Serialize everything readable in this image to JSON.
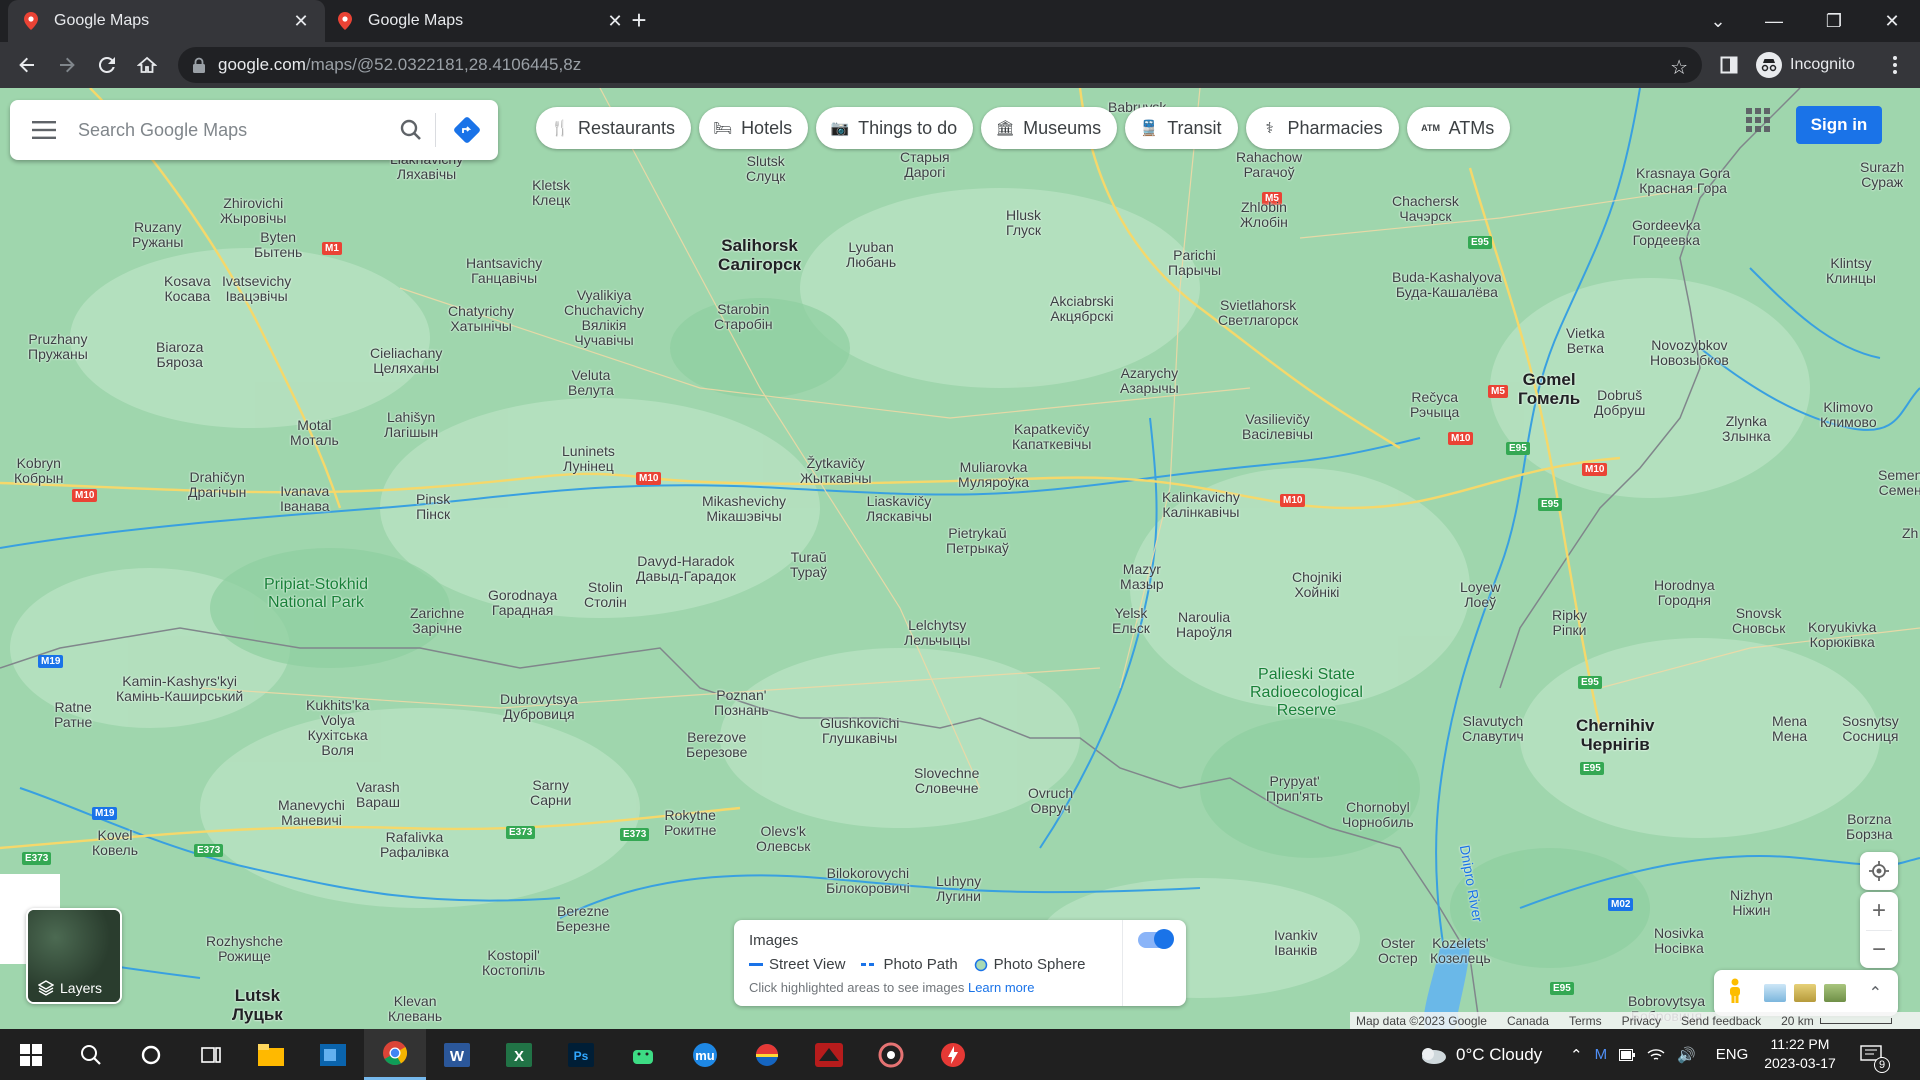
{
  "browser": {
    "tabs": [
      {
        "title": "Google Maps",
        "active": true
      },
      {
        "title": "Google Maps",
        "active": false
      }
    ],
    "new_tab_symbol": "+",
    "url_host": "google.com",
    "url_path": "/maps/@52.0322181,28.4106445,8z",
    "profile_label": "Incognito"
  },
  "maps": {
    "search_placeholder": "Search Google Maps",
    "chips": [
      {
        "label": "Restaurants",
        "icon": "fork-knife-icon"
      },
      {
        "label": "Hotels",
        "icon": "bed-icon"
      },
      {
        "label": "Things to do",
        "icon": "camera-icon"
      },
      {
        "label": "Museums",
        "icon": "museum-icon"
      },
      {
        "label": "Transit",
        "icon": "train-icon"
      },
      {
        "label": "Pharmacies",
        "icon": "pharmacy-icon"
      },
      {
        "label": "ATMs",
        "icon": "atm-icon"
      }
    ],
    "sign_in": "Sign in",
    "layers_label": "Layers",
    "images_panel": {
      "title": "Images",
      "street_view": "Street View",
      "photo_path": "Photo Path",
      "photo_sphere": "Photo Sphere",
      "note": "Click highlighted areas to see images",
      "learn_more": "Learn more",
      "toggle_on": true
    },
    "footer": {
      "map_data": "Map data ©2023 Google",
      "country": "Canada",
      "terms": "Terms",
      "privacy": "Privacy",
      "feedback": "Send feedback",
      "scale": "20 km"
    },
    "places": [
      {
        "name": "Babruysk",
        "cls": ""
      },
      {
        "name": "Slutsk\nСлуцк",
        "cls": ""
      },
      {
        "name": "Старыя\nДарогі",
        "cls": ""
      },
      {
        "name": "Soligorsk",
        "cls": "big"
      },
      {
        "name": "Lyuban\nЛюбань",
        "cls": ""
      },
      {
        "name": "Hlusk\nГлуск",
        "cls": ""
      },
      {
        "name": "Zhlobin\nЖлобін",
        "cls": ""
      },
      {
        "name": "Rahachow\nРагачоў",
        "cls": ""
      },
      {
        "name": "Chachersk\nЧачэрск",
        "cls": ""
      },
      {
        "name": "Krasnaya Gora\nКрасная Гора",
        "cls": ""
      },
      {
        "name": "Surazh\nСураж",
        "cls": ""
      }
    ]
  },
  "taskbar": {
    "weather": "0°C  Cloudy",
    "language": "ENG",
    "time": "11:22 PM",
    "date": "2023-03-17",
    "notifications": "9"
  }
}
